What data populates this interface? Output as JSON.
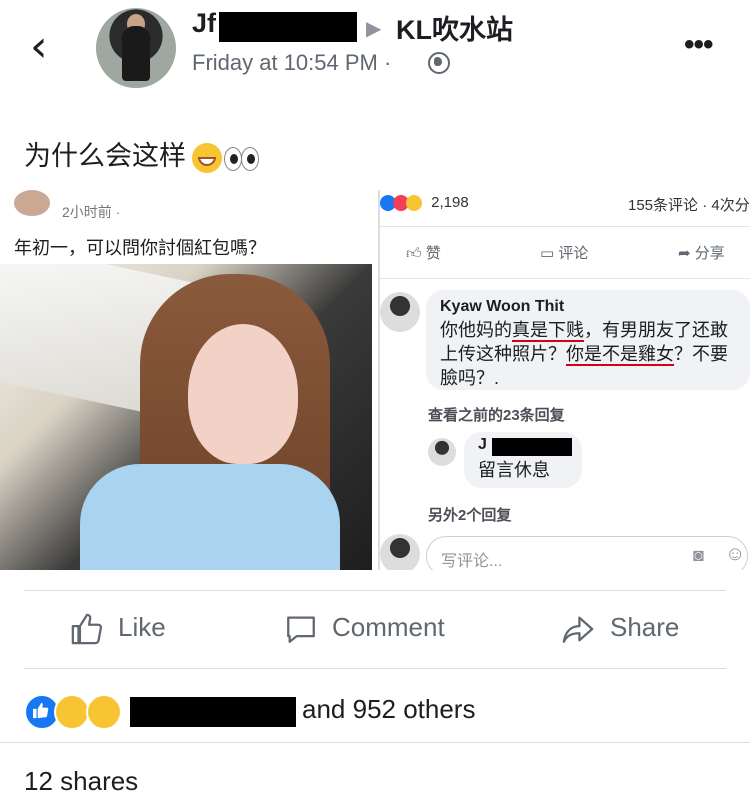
{
  "header": {
    "author_prefix": "Jf",
    "group_arrow": "▶",
    "group_name": "KL吹水站",
    "timestamp": "Friday at 10:54 PM ·",
    "back_icon": "chevron-left-icon",
    "more_icon": "more-dots-icon"
  },
  "post": {
    "text": "为什么会这样"
  },
  "screenshot_left": {
    "time": "2小时前 ·",
    "text": "年初一，可以問你討個紅包嗎？"
  },
  "screenshot_right": {
    "reaction_count": "2,198",
    "comment_share": "155条评论 · 4次分",
    "like_label": "赞",
    "comment_label": "评论",
    "share_label": "分享",
    "comment_author": "Kyaw Woon Thit",
    "comment_line1_a": "你他妈的",
    "comment_line1_b": "真是下贱",
    "comment_line1_c": "，有男朋友了还敢",
    "comment_line2_a": "上传这种照片？",
    "comment_line2_b": "你是不是雞女",
    "comment_line2_c": "？不要",
    "comment_line3": "臉吗？.",
    "view_previous": "查看之前的23条回复",
    "reply_author_prefix": "J",
    "reply_text": "留言休息",
    "more_replies": "另外2个回复",
    "write_placeholder": "写评论..."
  },
  "actions": {
    "like": "Like",
    "comment": "Comment",
    "share": "Share"
  },
  "footer": {
    "others": "and 952 others",
    "shares": "12 shares"
  },
  "colors": {
    "like_blue": "#1877f2",
    "haha_yellow": "#f7c531"
  }
}
